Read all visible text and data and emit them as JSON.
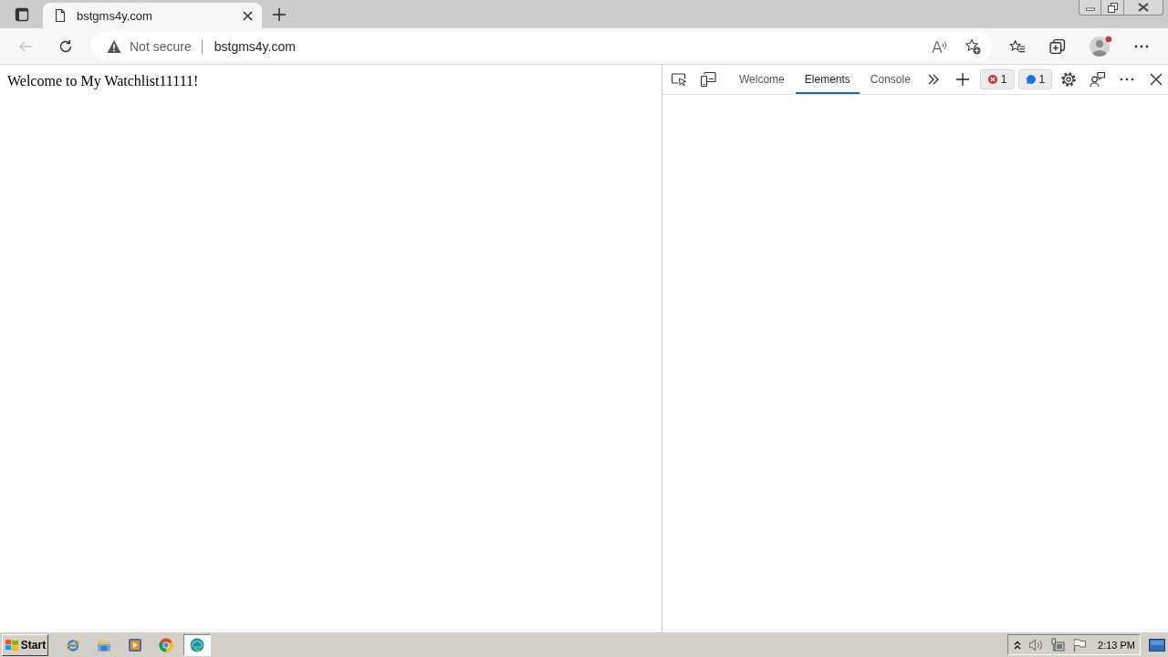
{
  "browser_tabs": [
    {
      "title": "bstgms4y.com",
      "selected": true
    }
  ],
  "nav_buttons": [
    {
      "kind": "back",
      "disabled": true
    },
    {
      "kind": "refresh",
      "disabled": false
    }
  ],
  "address_bar": {
    "security_label": "Not secure",
    "url": "bstgms4y.com"
  },
  "page": {
    "text": "Welcome to My Watchlist11111!"
  },
  "devtools": {
    "tabs": [
      {
        "label": "Welcome",
        "selected": false
      },
      {
        "label": "Elements",
        "selected": true
      },
      {
        "label": "Console",
        "selected": false
      }
    ],
    "badges": [
      {
        "kind": "error",
        "count": "1"
      },
      {
        "kind": "info",
        "count": "1"
      }
    ]
  },
  "taskbar": {
    "start_label": "Start",
    "apps": [
      {
        "kind": "explorer",
        "selected": false
      },
      {
        "kind": "folder",
        "selected": false
      },
      {
        "kind": "player",
        "selected": false
      },
      {
        "kind": "chrome",
        "selected": false
      },
      {
        "kind": "edge",
        "selected": true
      }
    ],
    "clock": "2:13 PM"
  }
}
